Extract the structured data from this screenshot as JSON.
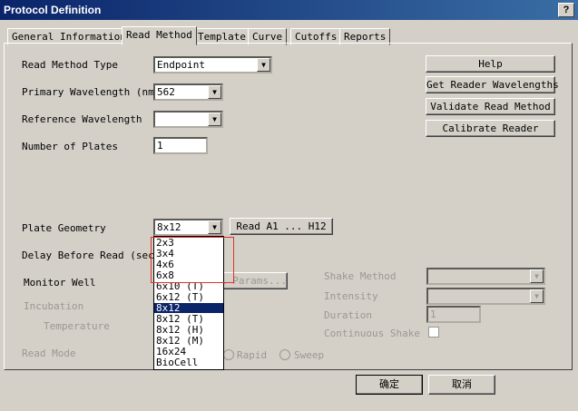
{
  "window": {
    "title": "Protocol Definition",
    "help_button": "?"
  },
  "tabs": [
    {
      "label": "General Information"
    },
    {
      "label": "Read Method"
    },
    {
      "label": "Template"
    },
    {
      "label": "Curve"
    },
    {
      "label": "Cutoffs"
    },
    {
      "label": "Reports"
    }
  ],
  "form": {
    "read_method_type_label": "Read Method Type",
    "read_method_type_value": "Endpoint",
    "primary_wavelength_label": "Primary Wavelength (nm)",
    "primary_wavelength_value": "562",
    "reference_wavelength_label": "Reference Wavelength",
    "reference_wavelength_value": "",
    "number_of_plates_label": "Number of Plates",
    "number_of_plates_value": "1",
    "plate_geometry_label": "Plate Geometry",
    "plate_geometry_value": "8x12",
    "read_range_button": "Read A1 ... H12",
    "delay_before_read_label": "Delay Before Read (sec)",
    "monitor_well_label": "Monitor Well",
    "params_button": "Well Params...",
    "incubation_label": "Incubation",
    "temperature_label": "Temperature",
    "read_mode_label": "Read Mode",
    "rapid_label": "Rapid",
    "sweep_label": "Sweep"
  },
  "shake": {
    "method_label": "Shake Method",
    "intensity_label": "Intensity",
    "duration_label": "Duration",
    "duration_value": "1",
    "continuous_label": "Continuous Shake"
  },
  "side_buttons": {
    "help": "Help",
    "get_wavelengths": "Get Reader Wavelengths",
    "validate": "Validate Read Method",
    "calibrate": "Calibrate Reader"
  },
  "plate_geometry_options": [
    "2x3",
    "3x4",
    "4x6",
    "6x8",
    "6x10 (T)",
    "6x12 (T)",
    "8x12",
    "8x12 (T)",
    "8x12 (H)",
    "8x12 (M)",
    "16x24",
    "BioCell"
  ],
  "plate_geometry_selected": "8x12",
  "footer": {
    "ok_button": "确定",
    "cancel_button": "取消"
  }
}
